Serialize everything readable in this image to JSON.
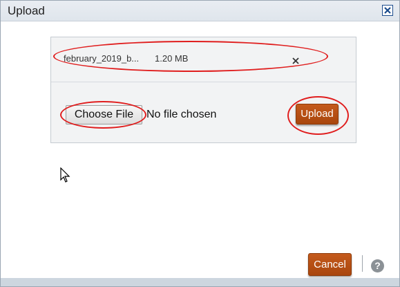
{
  "dialog": {
    "title": "Upload",
    "close_icon": "close-icon"
  },
  "upload_panel": {
    "file": {
      "name": "february_2019_b...",
      "size": "1.20 MB",
      "remove_icon": "remove-file-icon",
      "remove_glyph": "×"
    },
    "choose_file_label": "Choose File",
    "no_file_text": "No file chosen",
    "upload_label": "Upload"
  },
  "footer": {
    "cancel_label": "Cancel",
    "help_icon": "help-icon",
    "help_glyph": "?"
  },
  "colors": {
    "accent_button": "#b34f14",
    "annotation_red": "#e01d1d",
    "titlebar": "#e4e9ef"
  }
}
